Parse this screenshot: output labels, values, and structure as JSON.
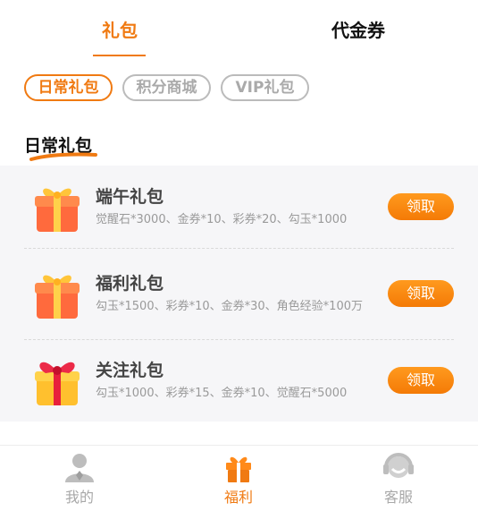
{
  "tabs": [
    {
      "label": "礼包",
      "active": true
    },
    {
      "label": "代金券",
      "active": false
    }
  ],
  "filters": [
    {
      "label": "日常礼包",
      "active": true
    },
    {
      "label": "积分商城",
      "active": false
    },
    {
      "label": "VIP礼包",
      "active": false
    }
  ],
  "section_title": "日常礼包",
  "packs": [
    {
      "title": "端午礼包",
      "desc": "觉醒石*3000、金券*10、彩券*20、勾玉*1000",
      "button": "领取",
      "icon": "gift-box-orange-icon"
    },
    {
      "title": "福利礼包",
      "desc": "勾玉*1500、彩券*10、金券*30、角色经验*100万",
      "button": "领取",
      "icon": "gift-box-orange-icon"
    },
    {
      "title": "关注礼包",
      "desc": "勾玉*1000、彩券*15、金券*10、觉醒石*5000",
      "button": "领取",
      "icon": "gift-box-red-yellow-icon"
    }
  ],
  "bottom_nav": [
    {
      "label": "我的",
      "icon": "user-icon",
      "active": false
    },
    {
      "label": "福利",
      "icon": "gift-icon",
      "active": true
    },
    {
      "label": "客服",
      "icon": "headset-icon",
      "active": false
    }
  ],
  "colors": {
    "accent": "#f07a12",
    "inactive": "#a8a8a8",
    "list_bg": "#f6f6f8"
  }
}
